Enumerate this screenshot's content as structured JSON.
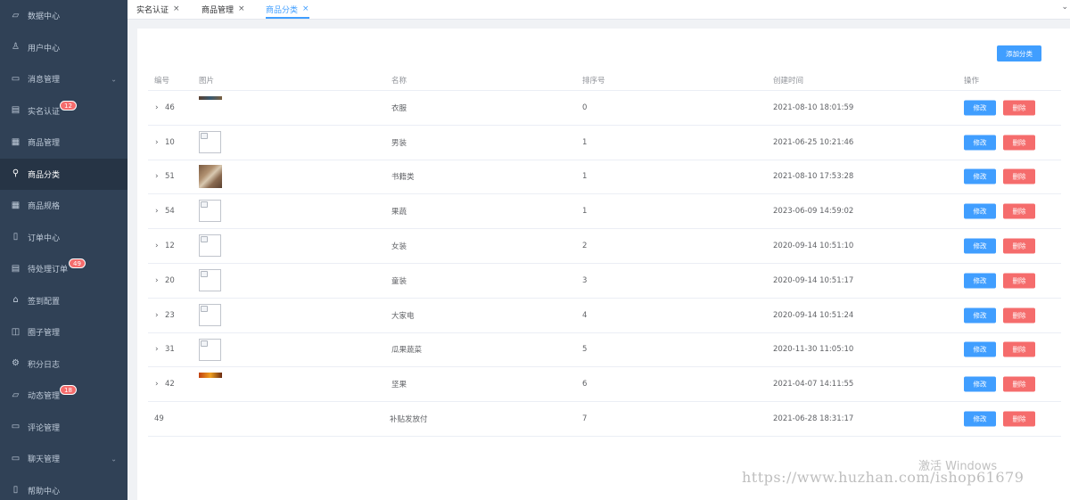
{
  "sidebar": {
    "items": [
      {
        "label": "数据中心",
        "icon": "chart-icon"
      },
      {
        "label": "用户中心",
        "icon": "user-icon"
      },
      {
        "label": "消息管理",
        "icon": "message-icon",
        "has_children": true
      },
      {
        "label": "实名认证",
        "icon": "id-card-icon",
        "badge": "12"
      },
      {
        "label": "商品管理",
        "icon": "grid-icon"
      },
      {
        "label": "商品分类",
        "icon": "category-icon",
        "active": true
      },
      {
        "label": "商品规格",
        "icon": "table-icon"
      },
      {
        "label": "订单中心",
        "icon": "clipboard-icon"
      },
      {
        "label": "待处理订单",
        "icon": "document-icon",
        "badge": "49"
      },
      {
        "label": "签到配置",
        "icon": "home-icon"
      },
      {
        "label": "圈子管理",
        "icon": "box-icon"
      },
      {
        "label": "积分日志",
        "icon": "gear-icon"
      },
      {
        "label": "动态管理",
        "icon": "chart-icon",
        "badge": "18"
      },
      {
        "label": "评论管理",
        "icon": "comment-icon"
      },
      {
        "label": "聊天管理",
        "icon": "chat-icon",
        "has_children": true
      },
      {
        "label": "帮助中心",
        "icon": "help-icon"
      }
    ]
  },
  "tabs": [
    {
      "label": "实名认证",
      "close": "×"
    },
    {
      "label": "商品管理",
      "close": "×"
    },
    {
      "label": "商品分类",
      "close": "×",
      "active": true
    }
  ],
  "toolbar": {
    "add_label": "添加分类"
  },
  "table": {
    "headers": {
      "id": "编号",
      "image": "图片",
      "name": "名称",
      "sort": "排序号",
      "created": "创建时间",
      "actions": "操作"
    },
    "rows": [
      {
        "id": "46",
        "name": "衣服",
        "sort": "0",
        "created": "2021-08-10 18:01:59",
        "image": "strip",
        "expandable": true
      },
      {
        "id": "10",
        "name": "男装",
        "sort": "1",
        "created": "2021-06-25 10:21:46",
        "image": "broken",
        "expandable": true
      },
      {
        "id": "51",
        "name": "书籍类",
        "sort": "1",
        "created": "2021-08-10 17:53:28",
        "image": "photo",
        "expandable": true
      },
      {
        "id": "54",
        "name": "果蔬",
        "sort": "1",
        "created": "2023-06-09 14:59:02",
        "image": "broken",
        "expandable": true
      },
      {
        "id": "12",
        "name": "女装",
        "sort": "2",
        "created": "2020-09-14 10:51:10",
        "image": "broken",
        "expandable": true
      },
      {
        "id": "20",
        "name": "童装",
        "sort": "3",
        "created": "2020-09-14 10:51:17",
        "image": "broken",
        "expandable": true
      },
      {
        "id": "23",
        "name": "大家电",
        "sort": "4",
        "created": "2020-09-14 10:51:24",
        "image": "broken",
        "expandable": true
      },
      {
        "id": "31",
        "name": "瓜果蔬菜",
        "sort": "5",
        "created": "2020-11-30 11:05:10",
        "image": "broken",
        "expandable": true
      },
      {
        "id": "42",
        "name": "坚果",
        "sort": "6",
        "created": "2021-04-07 14:11:55",
        "image": "fire",
        "expandable": true
      },
      {
        "id": "49",
        "name": "补贴发放付",
        "sort": "7",
        "created": "2021-06-28 18:31:17",
        "image": "none",
        "expandable": false
      }
    ],
    "edit_label": "修改",
    "delete_label": "删除"
  },
  "watermark": {
    "activate": "激活 Windows",
    "url": "https://www.huzhan.com/ishop61679"
  },
  "colors": {
    "primary": "#409eff",
    "danger": "#f56c6c",
    "sidebar_bg": "#304156"
  }
}
